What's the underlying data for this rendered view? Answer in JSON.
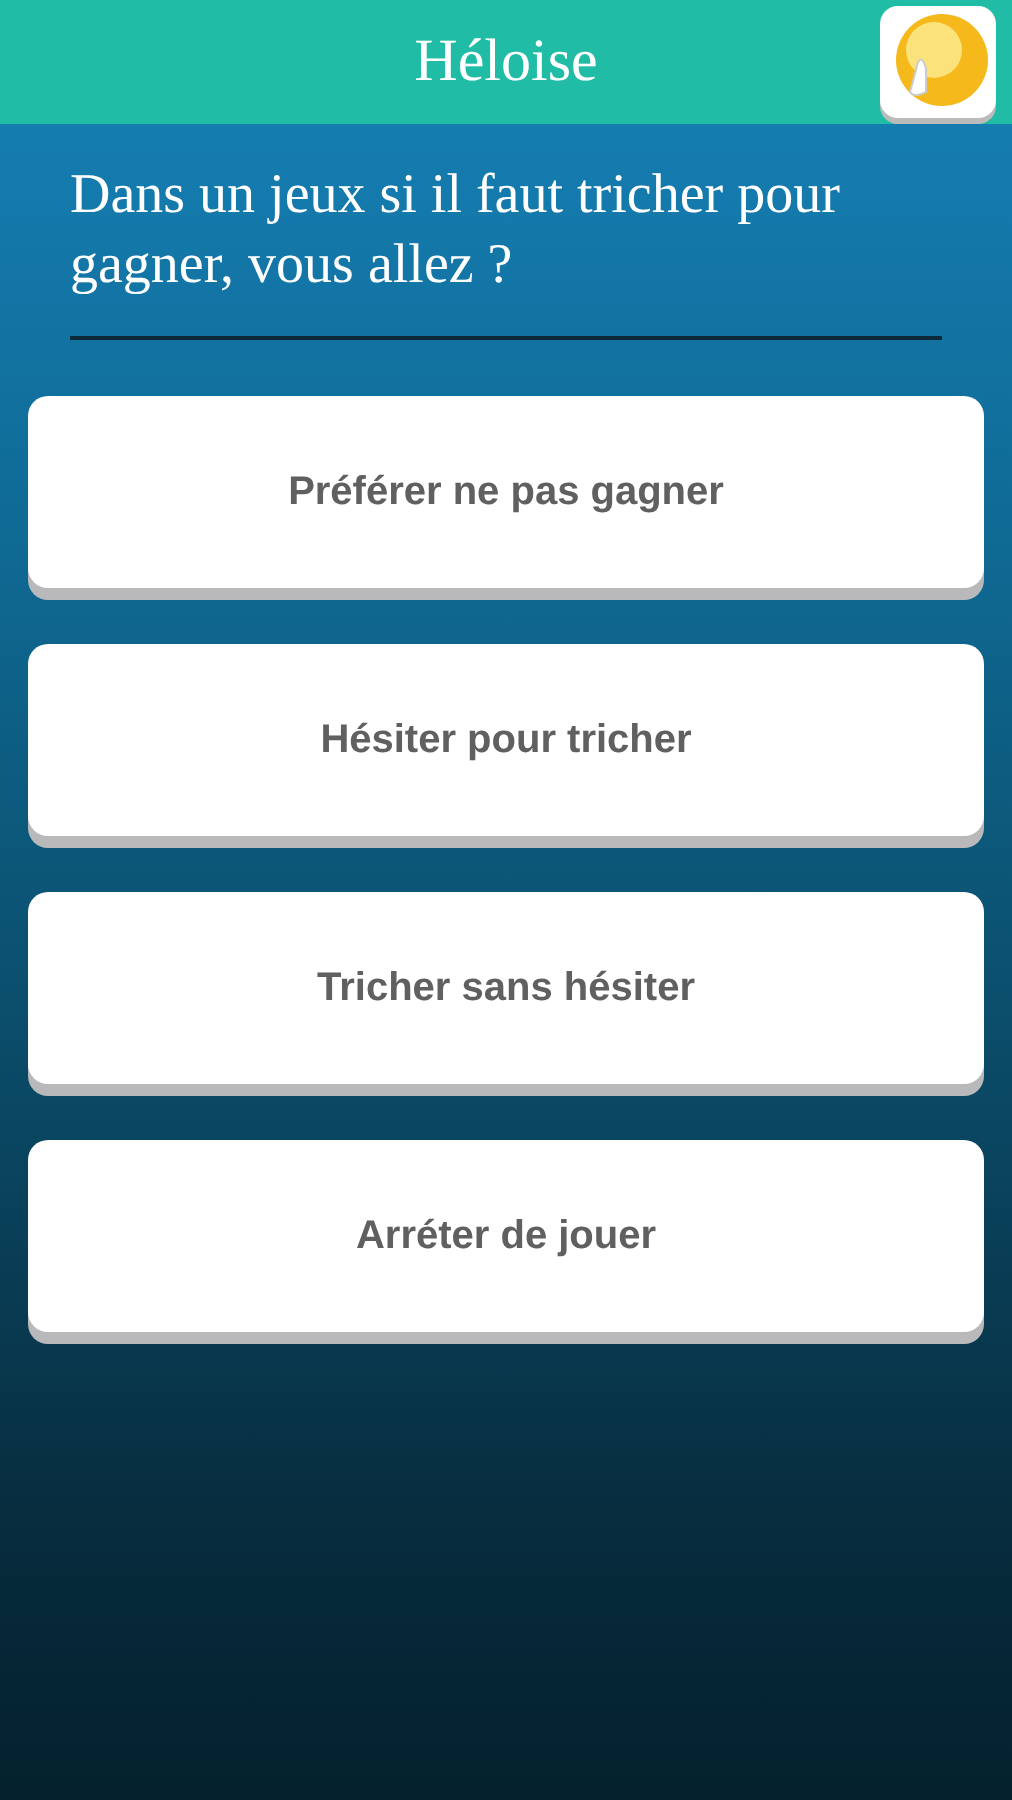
{
  "header": {
    "title": "Héloise"
  },
  "question": "Dans un jeux si il faut tricher pour gagner, vous allez ?",
  "answers": [
    {
      "label": "Préférer ne pas gagner"
    },
    {
      "label": "Hésiter pour tricher"
    },
    {
      "label": "Tricher sans hésiter"
    },
    {
      "label": "Arréter de jouer"
    }
  ]
}
